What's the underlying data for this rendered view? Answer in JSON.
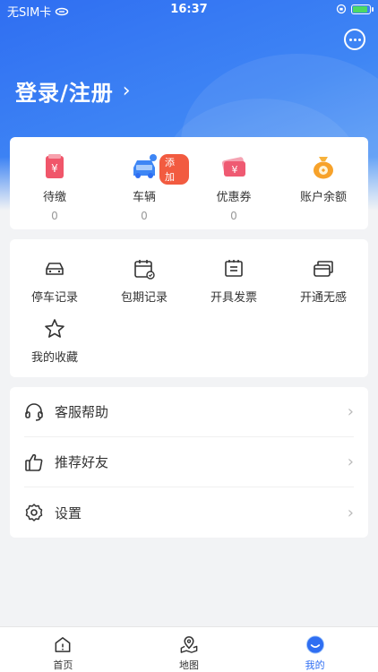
{
  "status_bar": {
    "carrier": "无SIM卡",
    "time": "16:37"
  },
  "header": {
    "login_text": "登录/注册",
    "message_icon": "chat-bubble-icon"
  },
  "stats": [
    {
      "label": "待缴",
      "value": "0",
      "icon": "pending-bill-icon"
    },
    {
      "label": "车辆",
      "value": "0",
      "icon": "car-icon",
      "badge": "添加"
    },
    {
      "label": "优惠券",
      "value": "0",
      "icon": "coupon-icon"
    },
    {
      "label": "账户余额",
      "value": "",
      "icon": "money-bag-icon"
    }
  ],
  "tools": [
    {
      "label": "停车记录",
      "icon": "car-outline-icon"
    },
    {
      "label": "包期记录",
      "icon": "calendar-icon"
    },
    {
      "label": "开具发票",
      "icon": "invoice-icon"
    },
    {
      "label": "开通无感",
      "icon": "card-icon"
    },
    {
      "label": "我的收藏",
      "icon": "star-icon"
    }
  ],
  "menu": [
    {
      "label": "客服帮助",
      "icon": "headset-icon"
    },
    {
      "label": "推荐好友",
      "icon": "thumbs-up-icon"
    },
    {
      "label": "设置",
      "icon": "gear-icon"
    }
  ],
  "tabbar": [
    {
      "label": "首页",
      "icon": "home-icon",
      "active": false
    },
    {
      "label": "地图",
      "icon": "map-icon",
      "active": false
    },
    {
      "label": "我的",
      "icon": "profile-icon",
      "active": true
    }
  ],
  "colors": {
    "primary": "#2f6ef2",
    "badge": "#f25b40",
    "background": "#f2f3f5"
  }
}
